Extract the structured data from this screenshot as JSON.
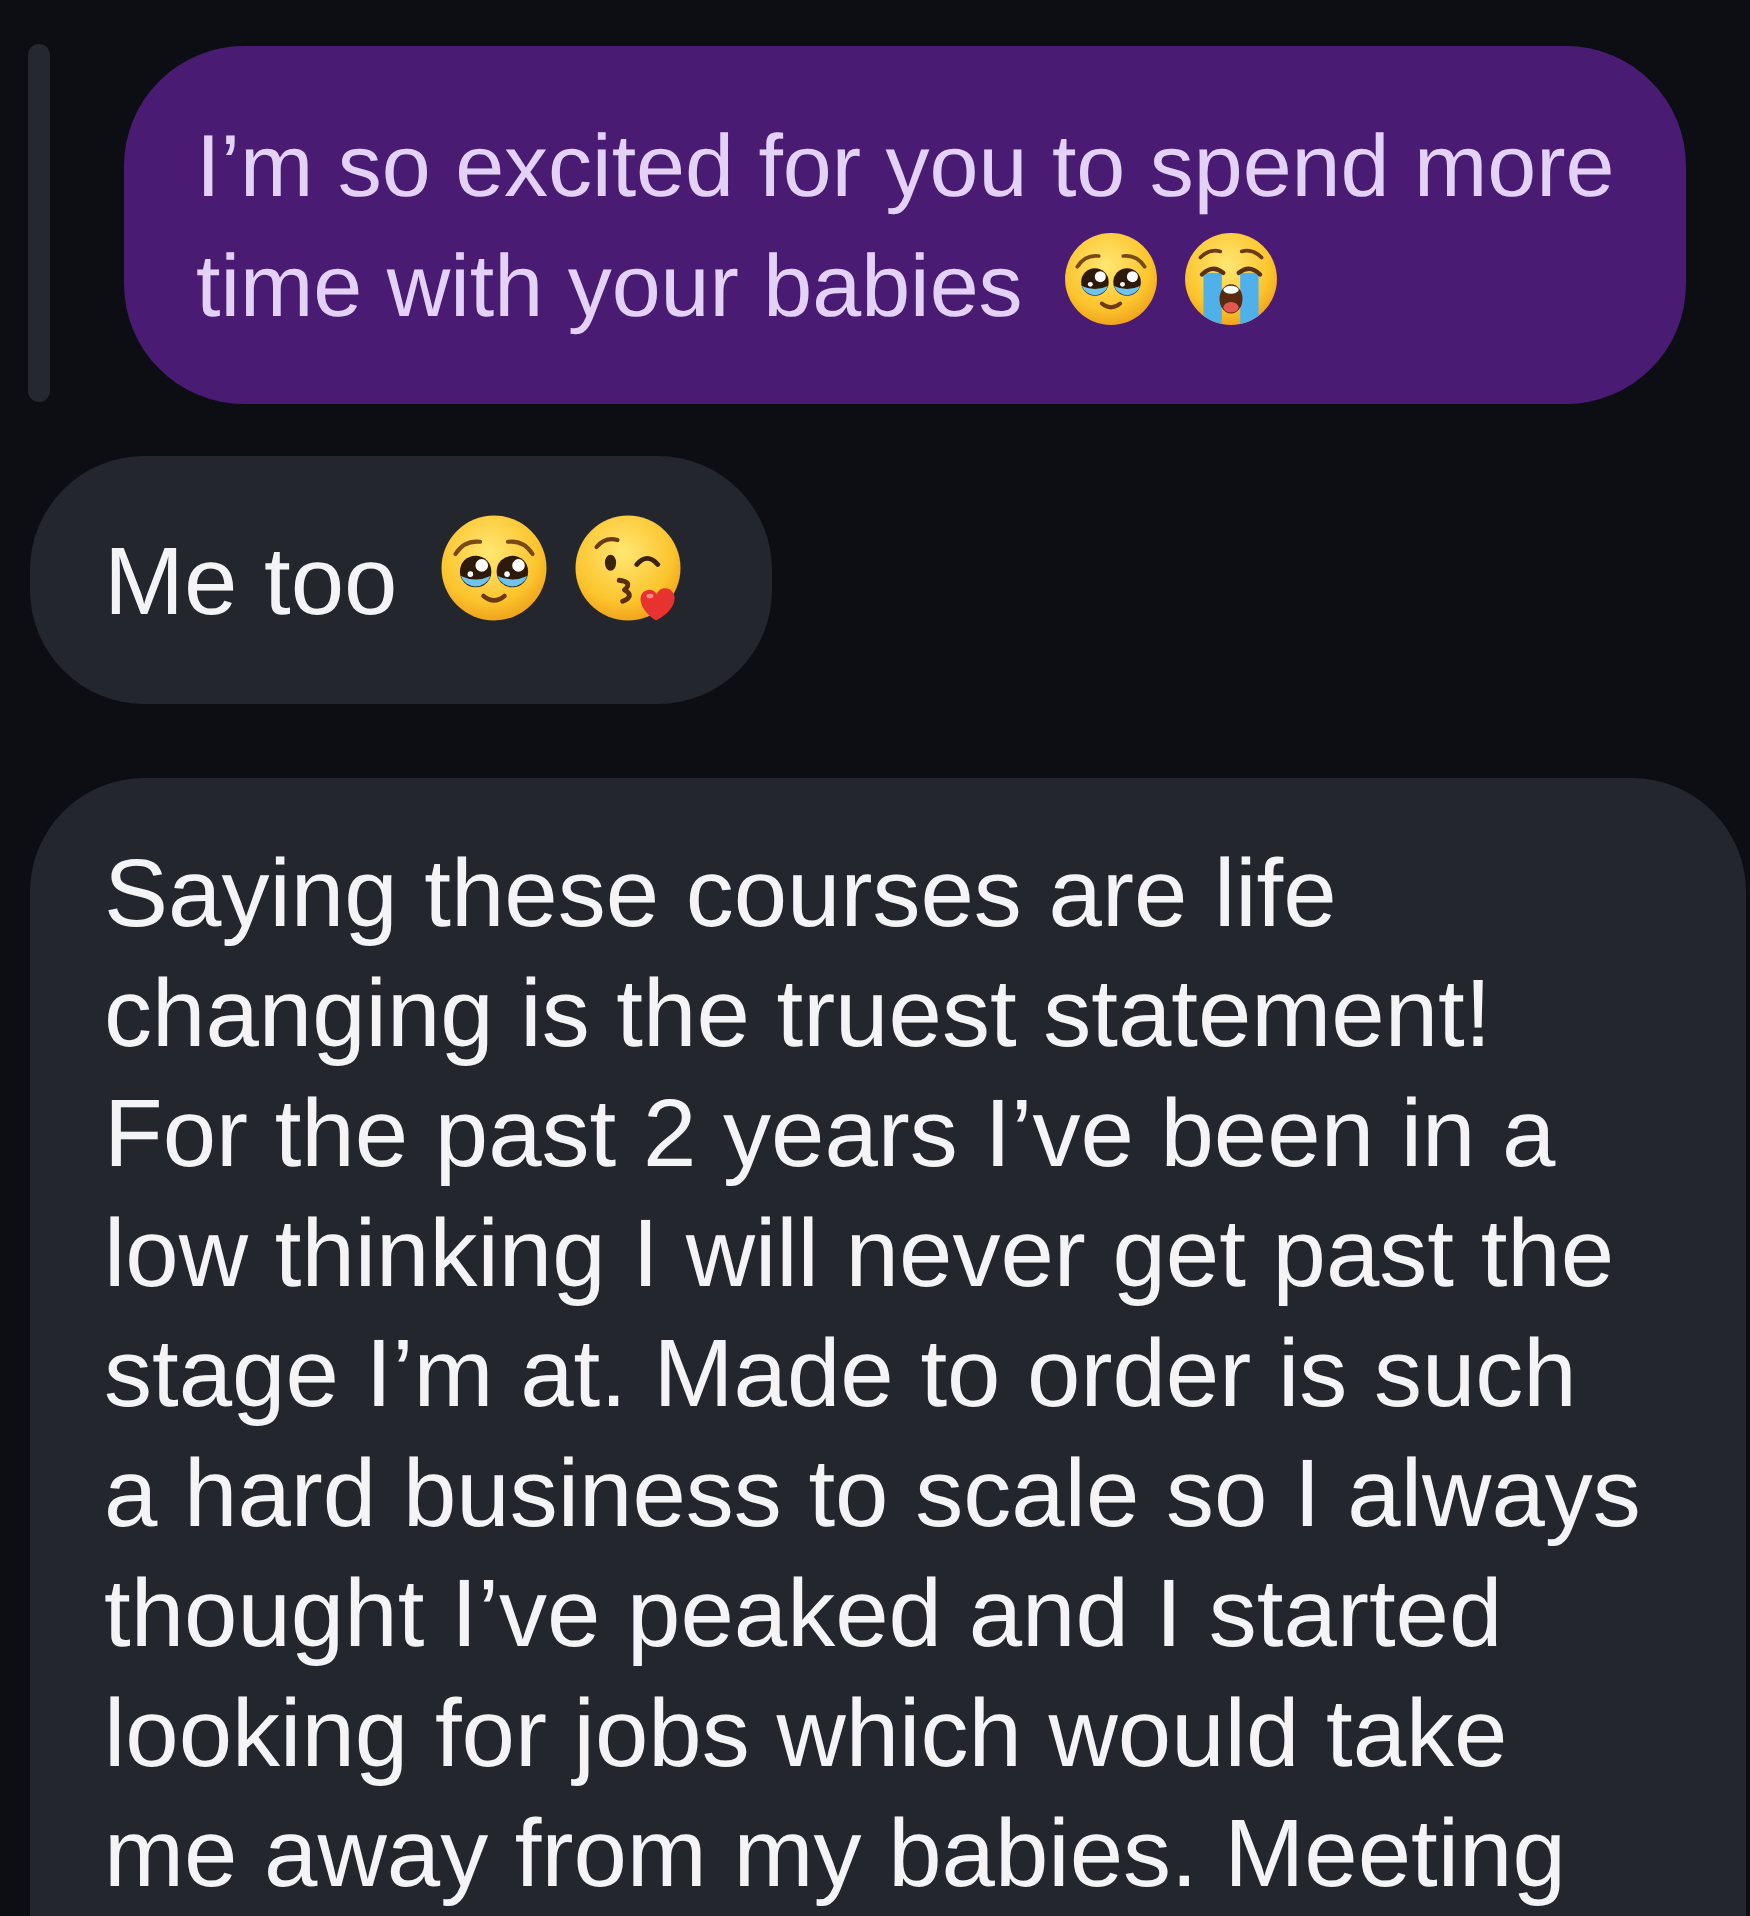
{
  "messages": [
    {
      "kind": "sent",
      "lines": [
        "I’m so excited for you to spend more",
        "time with your babies"
      ],
      "emojis": [
        {
          "kind": "pleading"
        },
        {
          "kind": "sob"
        }
      ]
    },
    {
      "kind": "received",
      "lines": [
        "Me too"
      ],
      "emojis": [
        {
          "kind": "pleading"
        },
        {
          "kind": "kiss"
        }
      ]
    },
    {
      "kind": "received",
      "text": "Saying these courses are life changing is the truest statement! For the past 2 years I’ve been in a low thinking I will never get past the stage I’m at. Made to order is such a hard business to scale so I always thought I’ve peaked and I started looking for jobs which would take me away from my babies. Meeting"
    }
  ]
}
